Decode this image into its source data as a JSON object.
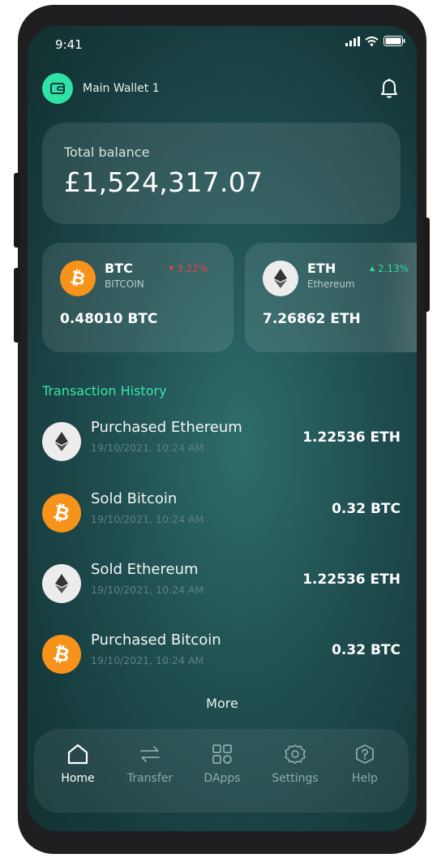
{
  "status_bar": {
    "time": "9:41"
  },
  "header": {
    "wallet_name": "Main Wallet 1"
  },
  "balance": {
    "label": "Total balance",
    "value": "£1,524,317.07"
  },
  "coins": [
    {
      "symbol": "BTC",
      "name": "BITCOIN",
      "change": "3.22%",
      "direction": "down",
      "amount": "0.48010 BTC",
      "icon": "bitcoin-icon"
    },
    {
      "symbol": "ETH",
      "name": "Ethereum",
      "change": "2.13%",
      "direction": "up",
      "amount": "7.26862 ETH",
      "icon": "ethereum-icon"
    }
  ],
  "transactions": {
    "title": "Transaction History",
    "items": [
      {
        "title": "Purchased Ethereum",
        "date": "19/10/2021, 10:24 AM",
        "amount": "1.22536 ETH",
        "icon": "ethereum-icon"
      },
      {
        "title": "Sold Bitcoin",
        "date": "19/10/2021, 10:24 AM",
        "amount": "0.32 BTC",
        "icon": "bitcoin-icon"
      },
      {
        "title": "Sold Ethereum",
        "date": "19/10/2021, 10:24 AM",
        "amount": "1.22536 ETH",
        "icon": "ethereum-icon"
      },
      {
        "title": "Purchased Bitcoin",
        "date": "19/10/2021, 10:24 AM",
        "amount": "0.32 BTC",
        "icon": "bitcoin-icon"
      }
    ],
    "more_label": "More"
  },
  "nav": [
    {
      "label": "Home",
      "icon": "home-icon",
      "active": true
    },
    {
      "label": "Transfer",
      "icon": "transfer-icon",
      "active": false
    },
    {
      "label": "DApps",
      "icon": "dapps-icon",
      "active": false
    },
    {
      "label": "Settings",
      "icon": "settings-icon",
      "active": false
    },
    {
      "label": "Help",
      "icon": "help-icon",
      "active": false
    }
  ],
  "colors": {
    "accent_green": "#37e6a6",
    "down_red": "#e0474c",
    "up_green": "#2fd9a0",
    "bitcoin_orange": "#f7931a"
  }
}
